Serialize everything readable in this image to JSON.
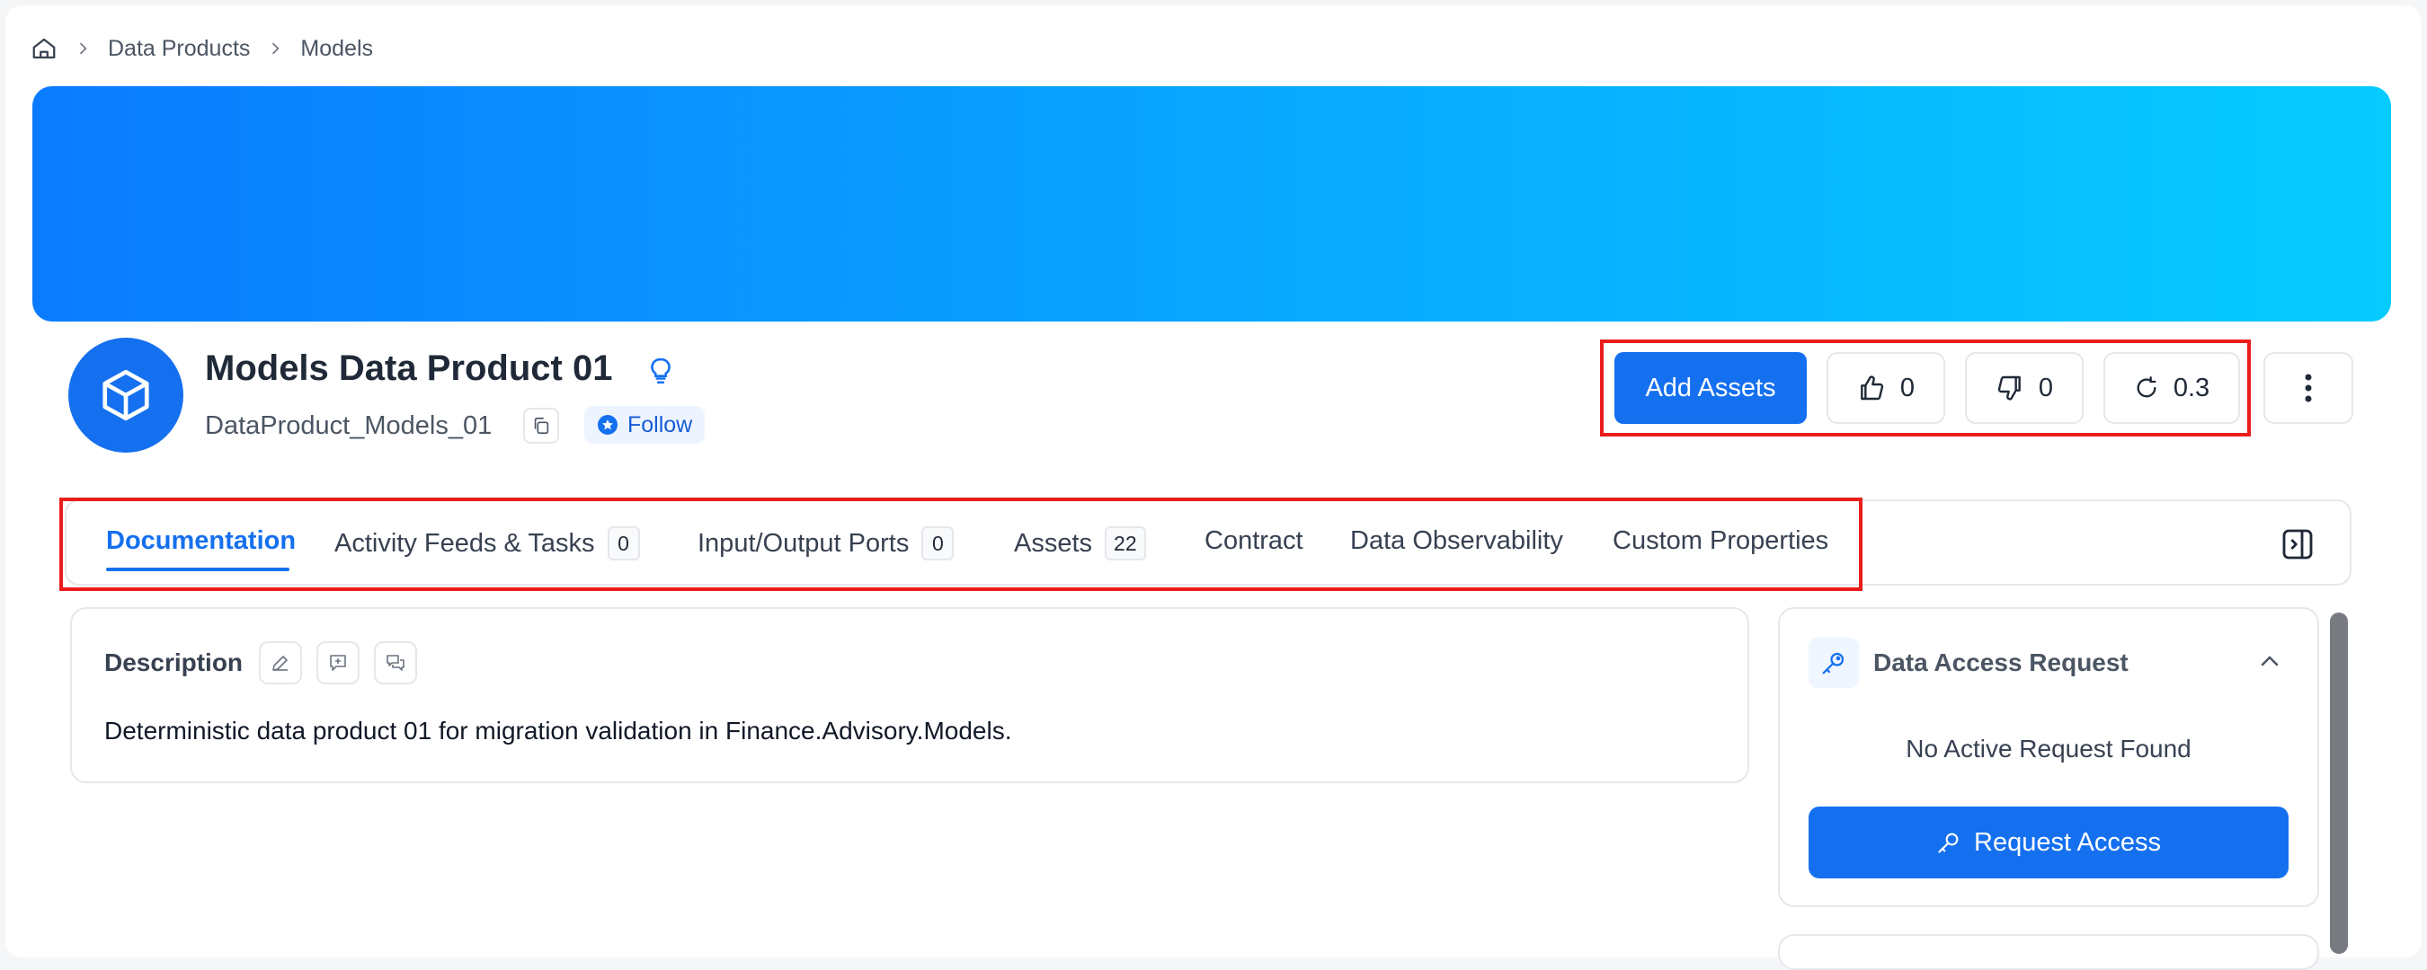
{
  "breadcrumb": {
    "items": [
      "Data Products",
      "Models"
    ]
  },
  "header": {
    "title": "Models Data Product 01",
    "fqn": "DataProduct_Models_01",
    "follow_label": "Follow"
  },
  "actions": {
    "add_assets_label": "Add Assets",
    "likes": "0",
    "dislikes": "0",
    "version": "0.3"
  },
  "tabs": [
    {
      "label": "Documentation",
      "active": true
    },
    {
      "label": "Activity Feeds & Tasks",
      "count": "0"
    },
    {
      "label": "Input/Output Ports",
      "count": "0"
    },
    {
      "label": "Assets",
      "count": "22"
    },
    {
      "label": "Contract"
    },
    {
      "label": "Data Observability"
    },
    {
      "label": "Custom Properties"
    }
  ],
  "description": {
    "label": "Description",
    "text": "Deterministic data product 01 for migration validation in Finance.Advisory.Models."
  },
  "data_access": {
    "title": "Data Access Request",
    "empty_text": "No Active Request Found",
    "request_label": "Request Access"
  },
  "colors": {
    "primary": "#1570ef",
    "highlight": "#ea1c1c",
    "banner_start": "#0a7bff",
    "banner_end": "#06cbff"
  }
}
